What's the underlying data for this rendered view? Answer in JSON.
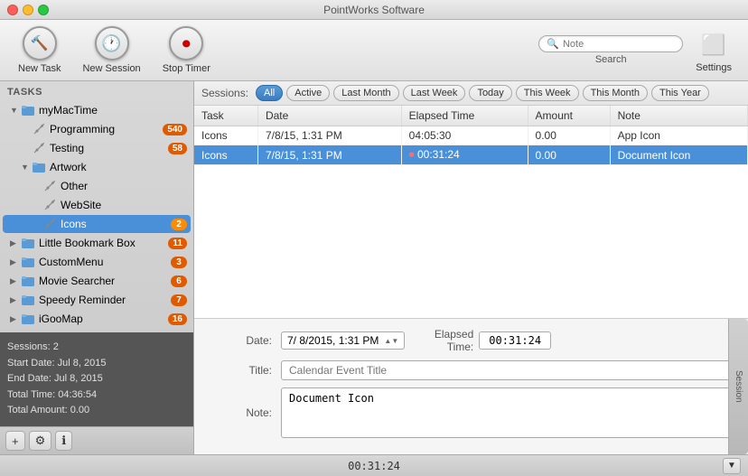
{
  "app": {
    "title": "PointWorks Software"
  },
  "toolbar": {
    "new_task_label": "New Task",
    "new_session_label": "New Session",
    "stop_timer_label": "Stop Timer",
    "search_placeholder": "Note",
    "search_label": "Search",
    "settings_label": "Settings"
  },
  "sidebar": {
    "header": "TASKS",
    "items": [
      {
        "id": "myMacTime",
        "label": "myMacTime",
        "level": 0,
        "type": "folder",
        "expanded": true,
        "badge": null
      },
      {
        "id": "Programming",
        "label": "Programming",
        "level": 1,
        "type": "tool",
        "badge": "540"
      },
      {
        "id": "Testing",
        "label": "Testing",
        "level": 1,
        "type": "tool",
        "badge": "58"
      },
      {
        "id": "Artwork",
        "label": "Artwork",
        "level": 1,
        "type": "folder",
        "expanded": true,
        "badge": null
      },
      {
        "id": "Other",
        "label": "Other",
        "level": 2,
        "type": "tool",
        "badge": null
      },
      {
        "id": "WebSite",
        "label": "WebSite",
        "level": 2,
        "type": "tool",
        "badge": null
      },
      {
        "id": "Icons",
        "label": "Icons",
        "level": 2,
        "type": "tool",
        "badge": "2",
        "selected": true
      },
      {
        "id": "LittleBookmarkBox",
        "label": "Little Bookmark Box",
        "level": 0,
        "type": "folder",
        "badge": "11"
      },
      {
        "id": "CustomMenu",
        "label": "CustomMenu",
        "level": 0,
        "type": "folder",
        "badge": "3"
      },
      {
        "id": "MovieSearcher",
        "label": "Movie Searcher",
        "level": 0,
        "type": "folder",
        "badge": "6"
      },
      {
        "id": "SpeedyReminder",
        "label": "Speedy Reminder",
        "level": 0,
        "type": "folder",
        "badge": "7"
      },
      {
        "id": "iGooMap",
        "label": "iGooMap",
        "level": 0,
        "type": "folder",
        "badge": "16"
      }
    ],
    "stats": {
      "sessions": "Sessions: 2",
      "start_date": "Start Date:  Jul 8, 2015",
      "end_date": "End Date:   Jul 8, 2015",
      "total_time": "Total Time:  04:36:54",
      "total_amount": "Total Amount:  0.00"
    },
    "bottom_buttons": [
      "+",
      "⚙",
      "ℹ"
    ]
  },
  "sessions_bar": {
    "label": "Sessions:",
    "filters": [
      {
        "id": "all",
        "label": "All",
        "active": true
      },
      {
        "id": "active",
        "label": "Active",
        "active": false
      },
      {
        "id": "last_month",
        "label": "Last Month",
        "active": false
      },
      {
        "id": "last_week",
        "label": "Last Week",
        "active": false
      },
      {
        "id": "today",
        "label": "Today",
        "active": false
      },
      {
        "id": "this_week",
        "label": "This Week",
        "active": false
      },
      {
        "id": "this_month",
        "label": "This Month",
        "active": false
      },
      {
        "id": "this_year",
        "label": "This Year",
        "active": false
      }
    ]
  },
  "table": {
    "columns": [
      "Task",
      "Date",
      "Elapsed Time",
      "Amount",
      "Note"
    ],
    "rows": [
      {
        "task": "Icons",
        "date": "7/8/15, 1:31 PM",
        "elapsed": "04:05:30",
        "amount": "0.00",
        "note": "App Icon",
        "selected": false,
        "recording": false
      },
      {
        "task": "Icons",
        "date": "7/8/15, 1:31 PM",
        "elapsed": "00:31:24",
        "amount": "0.00",
        "note": "Document Icon",
        "selected": true,
        "recording": true
      }
    ]
  },
  "detail": {
    "date_label": "Date:",
    "date_value": "7/ 8/2015,  1:31 PM",
    "elapsed_label": "Elapsed Time:",
    "elapsed_value": "00:31:24",
    "title_label": "Title:",
    "title_placeholder": "Calendar Event Title",
    "note_label": "Note:",
    "note_value": "Document Icon",
    "session_tab": "Session"
  },
  "statusbar": {
    "time": "00:31:24"
  }
}
